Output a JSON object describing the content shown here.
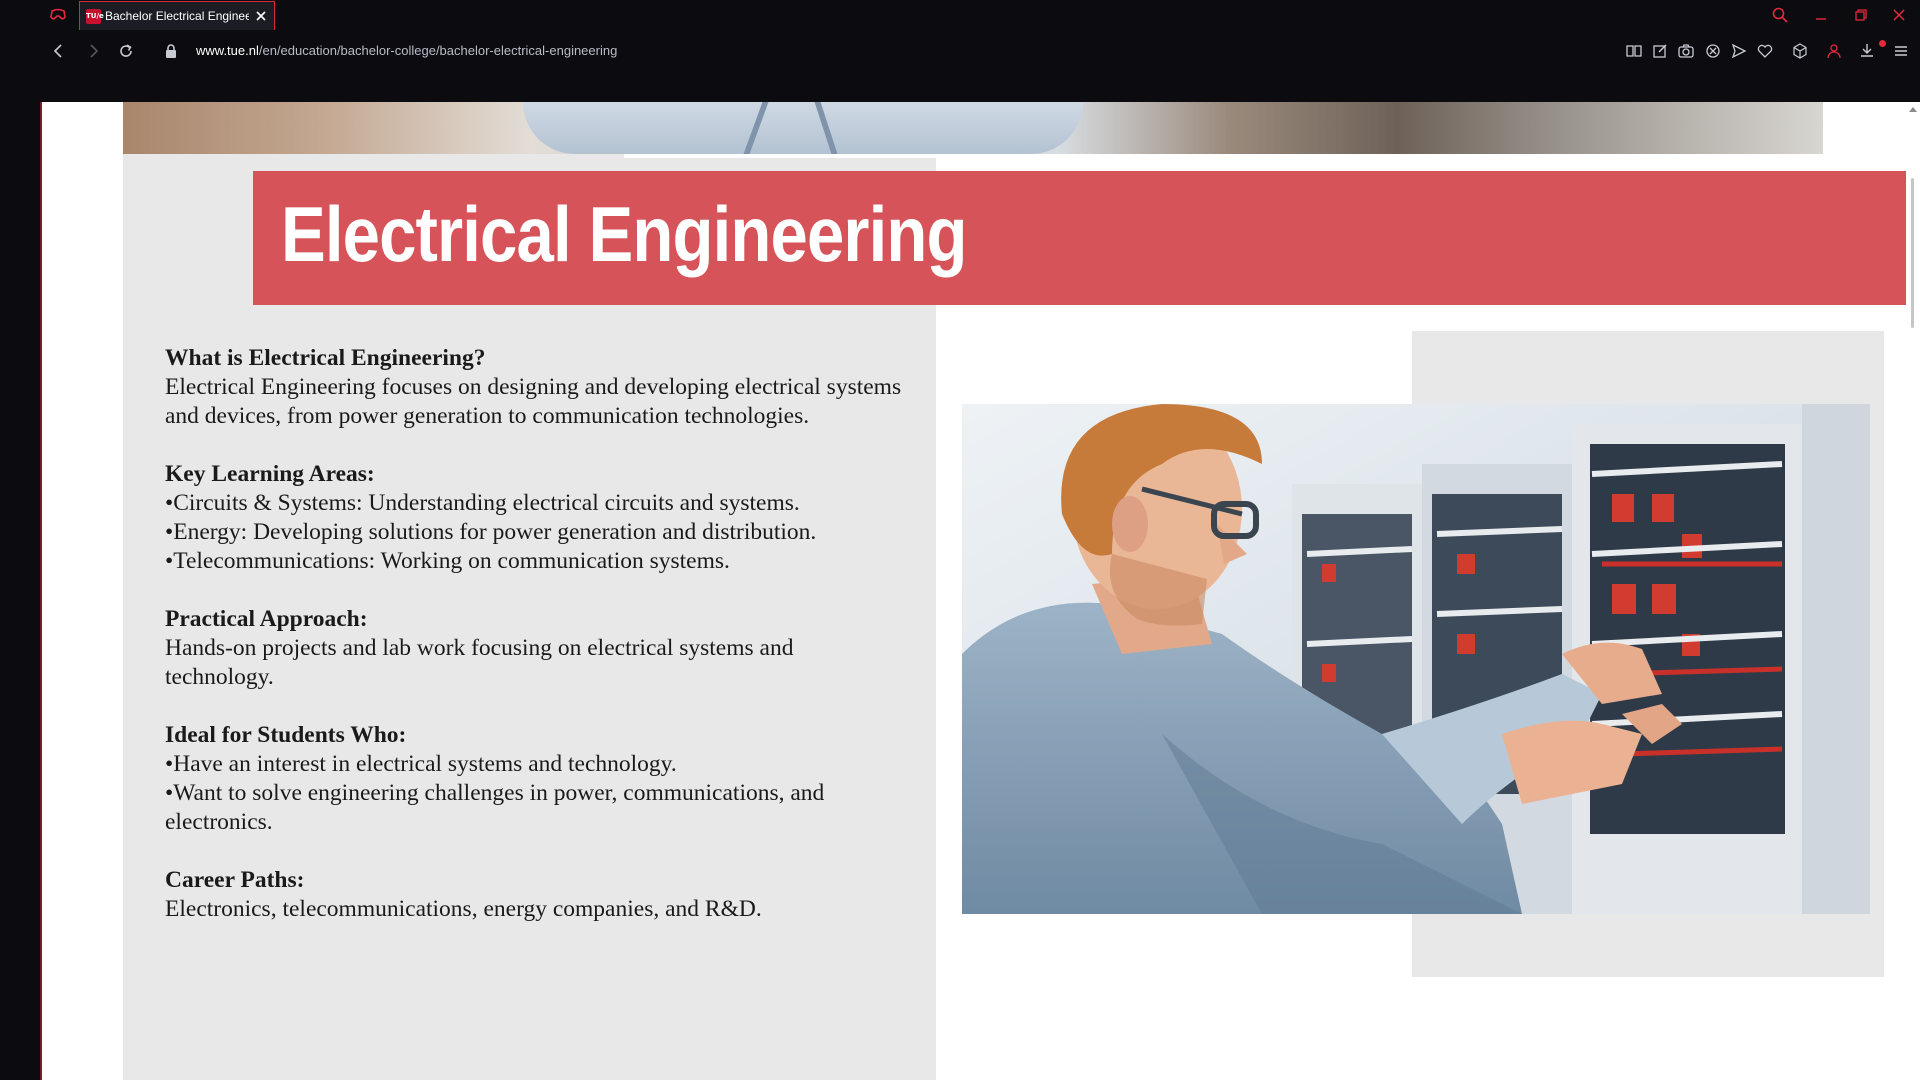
{
  "browser": {
    "tab": {
      "title": "Bachelor Electrical Enginee",
      "favicon_text": "TU/e"
    },
    "url": {
      "host": "www.tue.nl",
      "path": "/en/education/bachelor-college/bachelor-electrical-engineering"
    },
    "icons": [
      "gx-logo-icon",
      "search-icon",
      "minimize-icon",
      "restore-icon",
      "close-icon",
      "back-icon",
      "forward-icon",
      "reload-icon",
      "lock-icon",
      "reader-icon",
      "edit-icon",
      "camera-icon",
      "adblock-icon",
      "send-icon",
      "heart-icon",
      "cube-icon",
      "account-icon",
      "download-icon",
      "menu-icon"
    ],
    "accent_color": "#d5283d"
  },
  "page": {
    "banner": {
      "title": "Electrical Engineering",
      "color": "#d65359"
    },
    "sections": [
      {
        "heading": "What is Electrical Engineering?",
        "body": [
          "Electrical Engineering focuses on designing and developing electrical systems and devices, from power generation to communication technologies."
        ]
      },
      {
        "heading": "Key Learning Areas:",
        "body": [
          "•Circuits & Systems: Understanding electrical circuits and systems.",
          "•Energy: Developing solutions for power generation and distribution.",
          "•Telecommunications: Working on communication systems."
        ]
      },
      {
        "heading": "Practical Approach:",
        "body": [
          "Hands-on projects and lab work focusing on electrical systems and technology."
        ]
      },
      {
        "heading": "Ideal for Students Who:",
        "body": [
          "•Have an interest in electrical systems and technology.",
          "•Want to solve engineering challenges in power, communications, and electronics."
        ]
      },
      {
        "heading": "Career Paths:",
        "body": [
          "Electronics, telecommunications, energy companies, and R&D."
        ]
      }
    ]
  }
}
